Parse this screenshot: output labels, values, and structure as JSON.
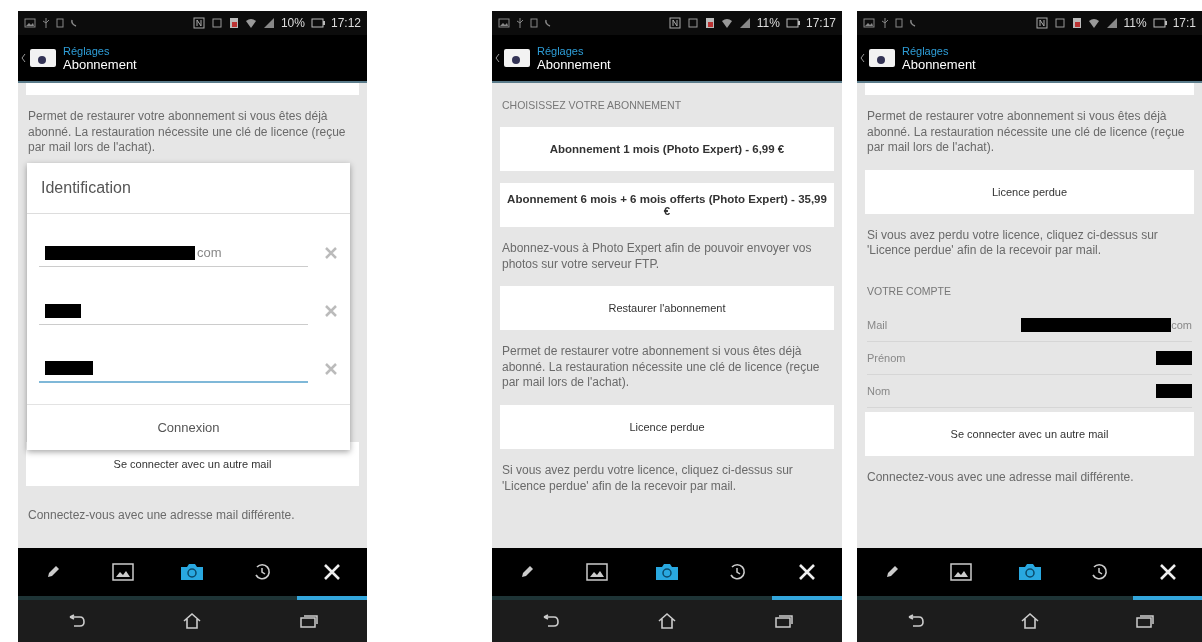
{
  "screens": [
    {
      "status_bar": {
        "battery": "10%",
        "time": "17:12"
      },
      "header": {
        "parent": "Réglages",
        "title": "Abonnement"
      },
      "content": [
        {
          "kind": "strip"
        },
        {
          "kind": "text",
          "text": "Permet de restaurer votre abonnement si vous êtes déjà abonné. La restauration nécessite une clé de licence (reçue par mail lors de l'achat)."
        }
      ],
      "content_bottom": [
        {
          "kind": "button",
          "text": "Se connecter avec un autre mail"
        },
        {
          "kind": "text",
          "text": "Connectez-vous avec une adresse mail différente."
        }
      ],
      "dialog": {
        "title": "Identification",
        "fields": [
          {
            "value": "com",
            "redacted": true,
            "focused": false
          },
          {
            "redacted": true,
            "focused": false
          },
          {
            "redacted": true,
            "focused": true
          }
        ],
        "button": "Connexion"
      },
      "tabs": [
        {
          "kind": "pencil",
          "selected": false
        },
        {
          "kind": "image",
          "selected": false
        },
        {
          "kind": "camera",
          "selected": false
        },
        {
          "kind": "history",
          "selected": false
        },
        {
          "kind": "tools",
          "selected": true
        }
      ]
    },
    {
      "status_bar": {
        "battery": "11%",
        "time": "17:17"
      },
      "header": {
        "parent": "Réglages",
        "title": "Abonnement"
      },
      "content": [
        {
          "kind": "section",
          "text": "CHOISISSEZ VOTRE ABONNEMENT"
        },
        {
          "kind": "bold-button",
          "text": "Abonnement 1 mois (Photo Expert) - 6,99 €"
        },
        {
          "kind": "bold-button",
          "text": "Abonnement 6 mois + 6 mois offerts (Photo Expert) - 35,99 €"
        },
        {
          "kind": "text",
          "text": "Abonnez-vous à Photo Expert afin de pouvoir envoyer vos photos sur votre serveur FTP."
        },
        {
          "kind": "button",
          "text": "Restaurer l'abonnement"
        },
        {
          "kind": "text",
          "text": "Permet de restaurer votre abonnement si vous êtes déjà abonné. La restauration nécessite une clé de licence (reçue par mail lors de l'achat)."
        },
        {
          "kind": "button",
          "text": "Licence perdue"
        },
        {
          "kind": "text",
          "text": "Si vous avez perdu votre licence, cliquez ci-dessus sur 'Licence perdue' afin de la recevoir par mail."
        }
      ],
      "tabs": [
        {
          "kind": "pencil",
          "selected": false
        },
        {
          "kind": "image",
          "selected": false
        },
        {
          "kind": "camera",
          "selected": false
        },
        {
          "kind": "history",
          "selected": false
        },
        {
          "kind": "tools",
          "selected": true
        }
      ]
    },
    {
      "status_bar": {
        "battery": "11%",
        "time": "17:1"
      },
      "header": {
        "parent": "Réglages",
        "title": "Abonnement"
      },
      "content": [
        {
          "kind": "strip"
        },
        {
          "kind": "text",
          "text": "Permet de restaurer votre abonnement si vous êtes déjà abonné. La restauration nécessite une clé de licence (reçue par mail lors de l'achat)."
        },
        {
          "kind": "button",
          "text": "Licence perdue"
        },
        {
          "kind": "text",
          "text": "Si vous avez perdu votre licence, cliquez ci-dessus sur 'Licence perdue' afin de la recevoir par mail."
        },
        {
          "kind": "section",
          "text": "VOTRE COMPTE"
        },
        {
          "kind": "row",
          "label": "Mail",
          "value": "com",
          "redacted": true
        },
        {
          "kind": "row",
          "label": "Prénom",
          "redacted": true
        },
        {
          "kind": "row",
          "label": "Nom",
          "redacted": true
        },
        {
          "kind": "button",
          "text": "Se connecter avec un autre mail"
        },
        {
          "kind": "text",
          "text": "Connectez-vous avec une adresse mail différente."
        }
      ],
      "tabs": [
        {
          "kind": "pencil",
          "selected": false
        },
        {
          "kind": "image",
          "selected": false
        },
        {
          "kind": "camera",
          "selected": false
        },
        {
          "kind": "history",
          "selected": false
        },
        {
          "kind": "tools",
          "selected": true
        }
      ]
    }
  ]
}
